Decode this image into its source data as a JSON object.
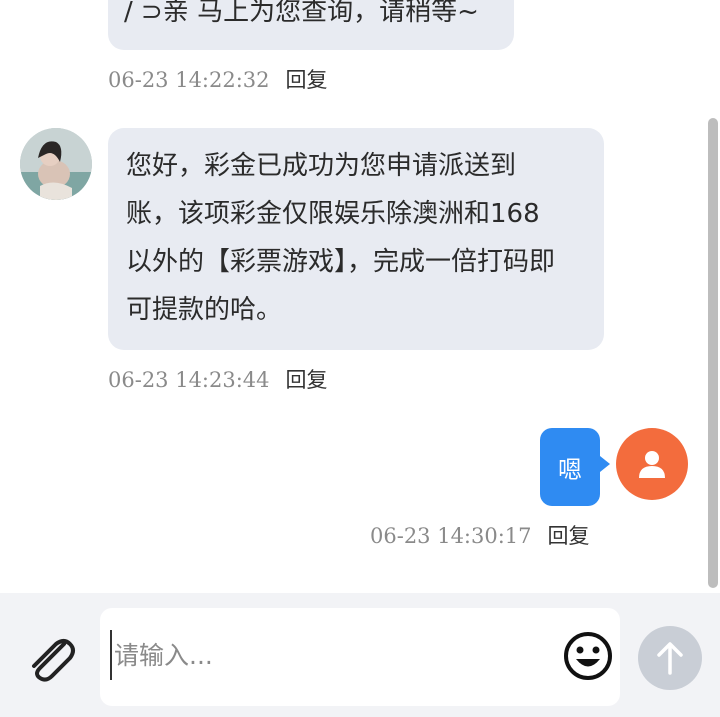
{
  "messages": {
    "previous": {
      "text": "/ ⊃亲 马上为您查询，请稍等~",
      "time": "06-23 14:22:32",
      "reply_label": "回复"
    },
    "agent": {
      "lines": [
        "您好，彩金已成功为您申请派送到",
        "账，该项彩金仅限娱乐除澳洲和168",
        "以外的【彩票游戏】，完成一倍打码即",
        "可提款的哈。"
      ],
      "time": "06-23 14:23:44",
      "reply_label": "回复"
    },
    "user": {
      "text": "嗯",
      "time": "06-23 14:30:17",
      "reply_label": "回复"
    }
  },
  "composer": {
    "placeholder": "请输入..."
  },
  "icons": {
    "attach": "paperclip-icon",
    "emoji": "smiley-icon",
    "send": "arrow-up-icon",
    "user_avatar": "person-icon"
  },
  "colors": {
    "agent_bubble": "#e8ebf2",
    "user_bubble": "#2f8bf2",
    "user_avatar": "#f36c3d",
    "send_button": "#c9ced6"
  }
}
